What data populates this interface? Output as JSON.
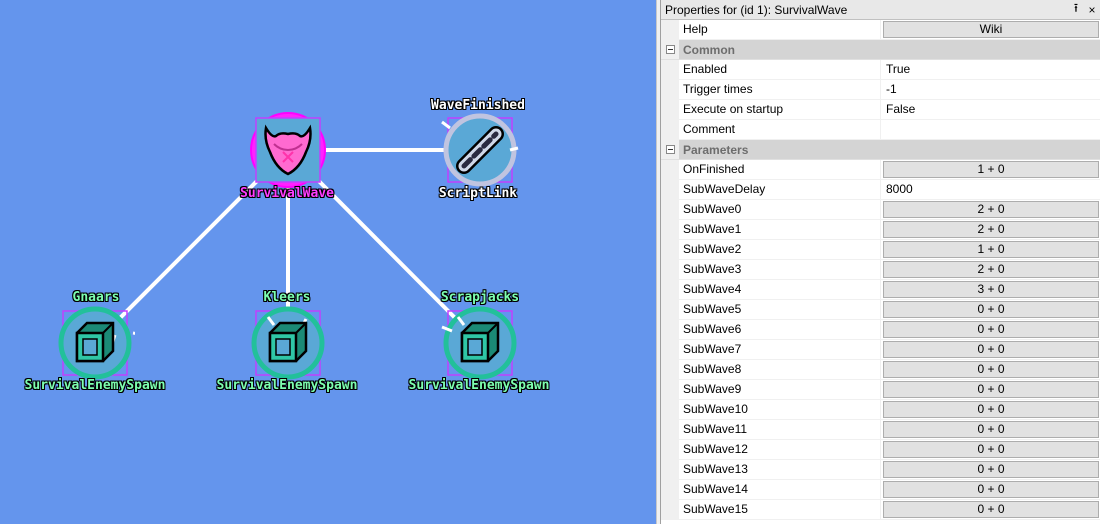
{
  "canvas": {
    "background": "#6495ed",
    "nodes": {
      "survival_wave": {
        "label": "SurvivalWave",
        "icon": "survival-wave-icon"
      },
      "script_link": {
        "label": "ScriptLink",
        "caption": "WaveFinished",
        "icon": "chain-link-icon"
      },
      "gnaars": {
        "label": "SurvivalEnemySpawn",
        "caption": "Gnaars",
        "icon": "cube-icon"
      },
      "kleers": {
        "label": "SurvivalEnemySpawn",
        "caption": "Kleers",
        "icon": "cube-icon"
      },
      "scrapjacks": {
        "label": "SurvivalEnemySpawn",
        "caption": "Scrapjacks",
        "icon": "cube-icon"
      }
    }
  },
  "panel": {
    "title": "Properties for (id 1): SurvivalWave",
    "pin_glyph": "⭱",
    "close_glyph": "×",
    "help": {
      "name": "Help",
      "value": "Wiki"
    },
    "categories": {
      "common": {
        "label": "Common",
        "rows": [
          {
            "name": "Enabled",
            "value": "True"
          },
          {
            "name": "Trigger times",
            "value": "-1"
          },
          {
            "name": "Execute on startup",
            "value": "False"
          },
          {
            "name": "Comment",
            "value": ""
          }
        ]
      },
      "parameters": {
        "label": "Parameters",
        "rows": [
          {
            "name": "OnFinished",
            "value": "1 + 0"
          },
          {
            "name": "SubWaveDelay",
            "value": "8000"
          },
          {
            "name": "SubWave0",
            "value": "2 + 0"
          },
          {
            "name": "SubWave1",
            "value": "2 + 0"
          },
          {
            "name": "SubWave2",
            "value": "1 + 0"
          },
          {
            "name": "SubWave3",
            "value": "2 + 0"
          },
          {
            "name": "SubWave4",
            "value": "3 + 0"
          },
          {
            "name": "SubWave5",
            "value": "0 + 0"
          },
          {
            "name": "SubWave6",
            "value": "0 + 0"
          },
          {
            "name": "SubWave7",
            "value": "0 + 0"
          },
          {
            "name": "SubWave8",
            "value": "0 + 0"
          },
          {
            "name": "SubWave9",
            "value": "0 + 0"
          },
          {
            "name": "SubWave10",
            "value": "0 + 0"
          },
          {
            "name": "SubWave11",
            "value": "0 + 0"
          },
          {
            "name": "SubWave12",
            "value": "0 + 0"
          },
          {
            "name": "SubWave13",
            "value": "0 + 0"
          },
          {
            "name": "SubWave14",
            "value": "0 + 0"
          },
          {
            "name": "SubWave15",
            "value": "0 + 0"
          }
        ]
      }
    }
  }
}
